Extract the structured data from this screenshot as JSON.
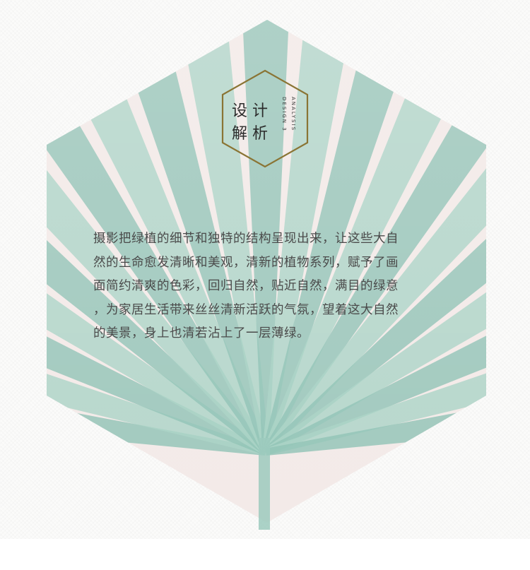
{
  "badge": {
    "title_line1": "设计",
    "title_line2": "解析",
    "subtitle_en_1": "ANALYSIS",
    "subtitle_en_2": "DESIGN 3",
    "frame_color": "#8a7434"
  },
  "body": {
    "lines": [
      "摄影把绿植的细节和独特的结构呈现出来，让这些大自",
      "然的生命愈发清晰和美观，清新的植物系列，赋予了画",
      "面简约清爽的色彩，回归自然，贴近自然，满目的绿意",
      "，为家居生活带来丝丝清新活跃的气氛，望着这大自然",
      "的美景，身上也清若沾上了一层薄绿。"
    ]
  },
  "art": {
    "leaf_color": "#a9d3c6",
    "leaf_dark_color": "#8fc2b4",
    "hexagon_tint": "#f3eae8",
    "subject": "fan-palm-leaf-photo"
  }
}
